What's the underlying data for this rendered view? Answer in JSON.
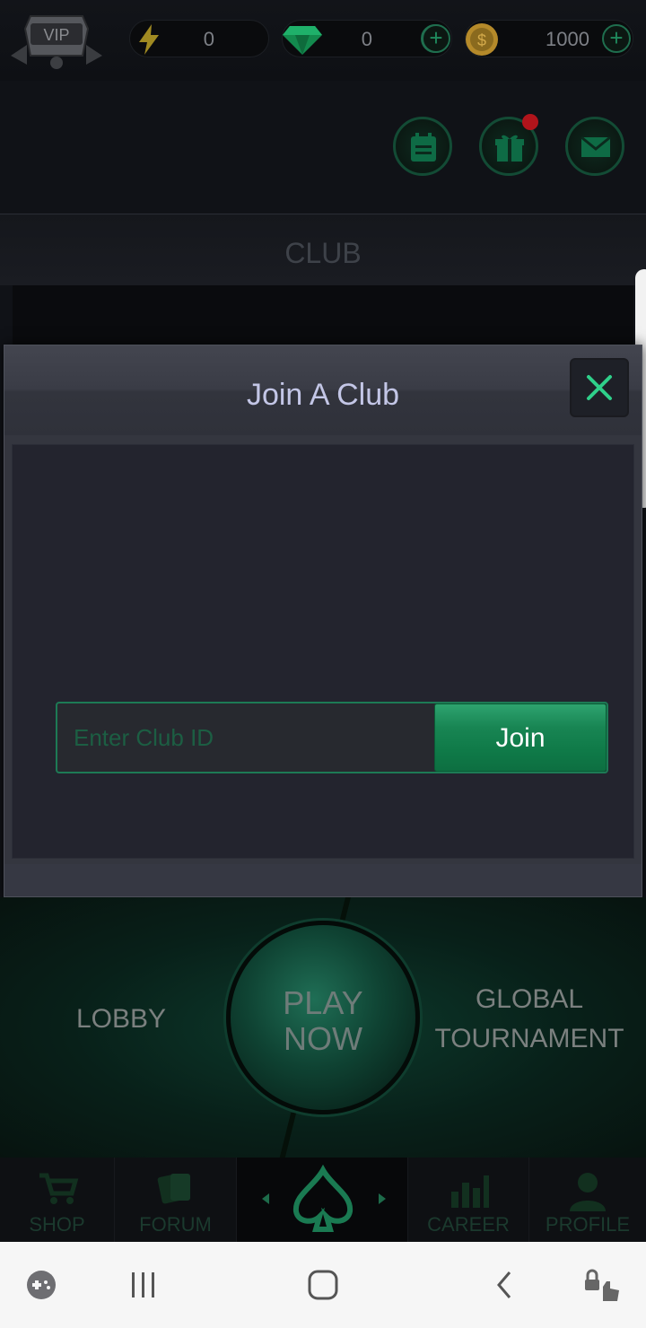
{
  "top_bar": {
    "vip_badge": "VIP",
    "energy_value": "0",
    "gems_value": "0",
    "coins_value": "1000",
    "plus_symbol": "+"
  },
  "header_icons": [
    "calendar-icon",
    "gift-icon",
    "mail-icon"
  ],
  "club": {
    "title": "CLUB"
  },
  "modal": {
    "title": "Join A Club",
    "input_placeholder": "Enter Club ID",
    "input_value": "",
    "join_label": "Join"
  },
  "hub": {
    "lobby": "LOBBY",
    "play_now_line1": "PLAY",
    "play_now_line2": "NOW",
    "global_line1": "GLOBAL",
    "global_line2": "TOURNAMENT"
  },
  "game_nav": {
    "items": [
      {
        "label": "SHOP",
        "icon": "cart-icon"
      },
      {
        "label": "FORUM",
        "icon": "cards-icon"
      },
      {
        "label": "",
        "icon": "spade-logo-icon"
      },
      {
        "label": "CAREER",
        "icon": "bar-chart-icon"
      },
      {
        "label": "PROFILE",
        "icon": "user-icon"
      }
    ]
  },
  "system_nav": [
    "game-tools-icon",
    "recents-icon",
    "home-icon",
    "back-icon",
    "assistive-touch-icon"
  ],
  "colors": {
    "accent_green": "#188553",
    "modal_title": "#c3c6e6",
    "close_x": "#2fd08a",
    "notification": "#b1141b"
  }
}
